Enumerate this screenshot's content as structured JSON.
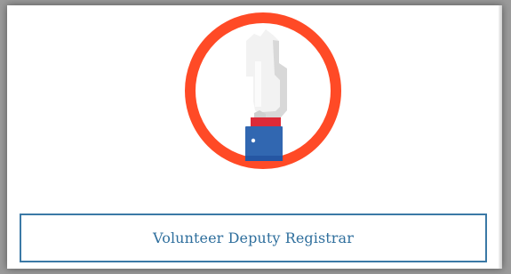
{
  "card": {
    "image": {
      "icon": "raised-hand-icon",
      "colors": {
        "ring": "#ff4a26",
        "hand": "#f2f2f2",
        "hand_shadow": "#d8d8d8",
        "cuff": "#3167b1",
        "cuff_accent": "#2556a3",
        "red_cuff": "#dd2a38"
      }
    },
    "button": {
      "label": "Volunteer Deputy Registrar",
      "color": "#3b79a6"
    }
  }
}
